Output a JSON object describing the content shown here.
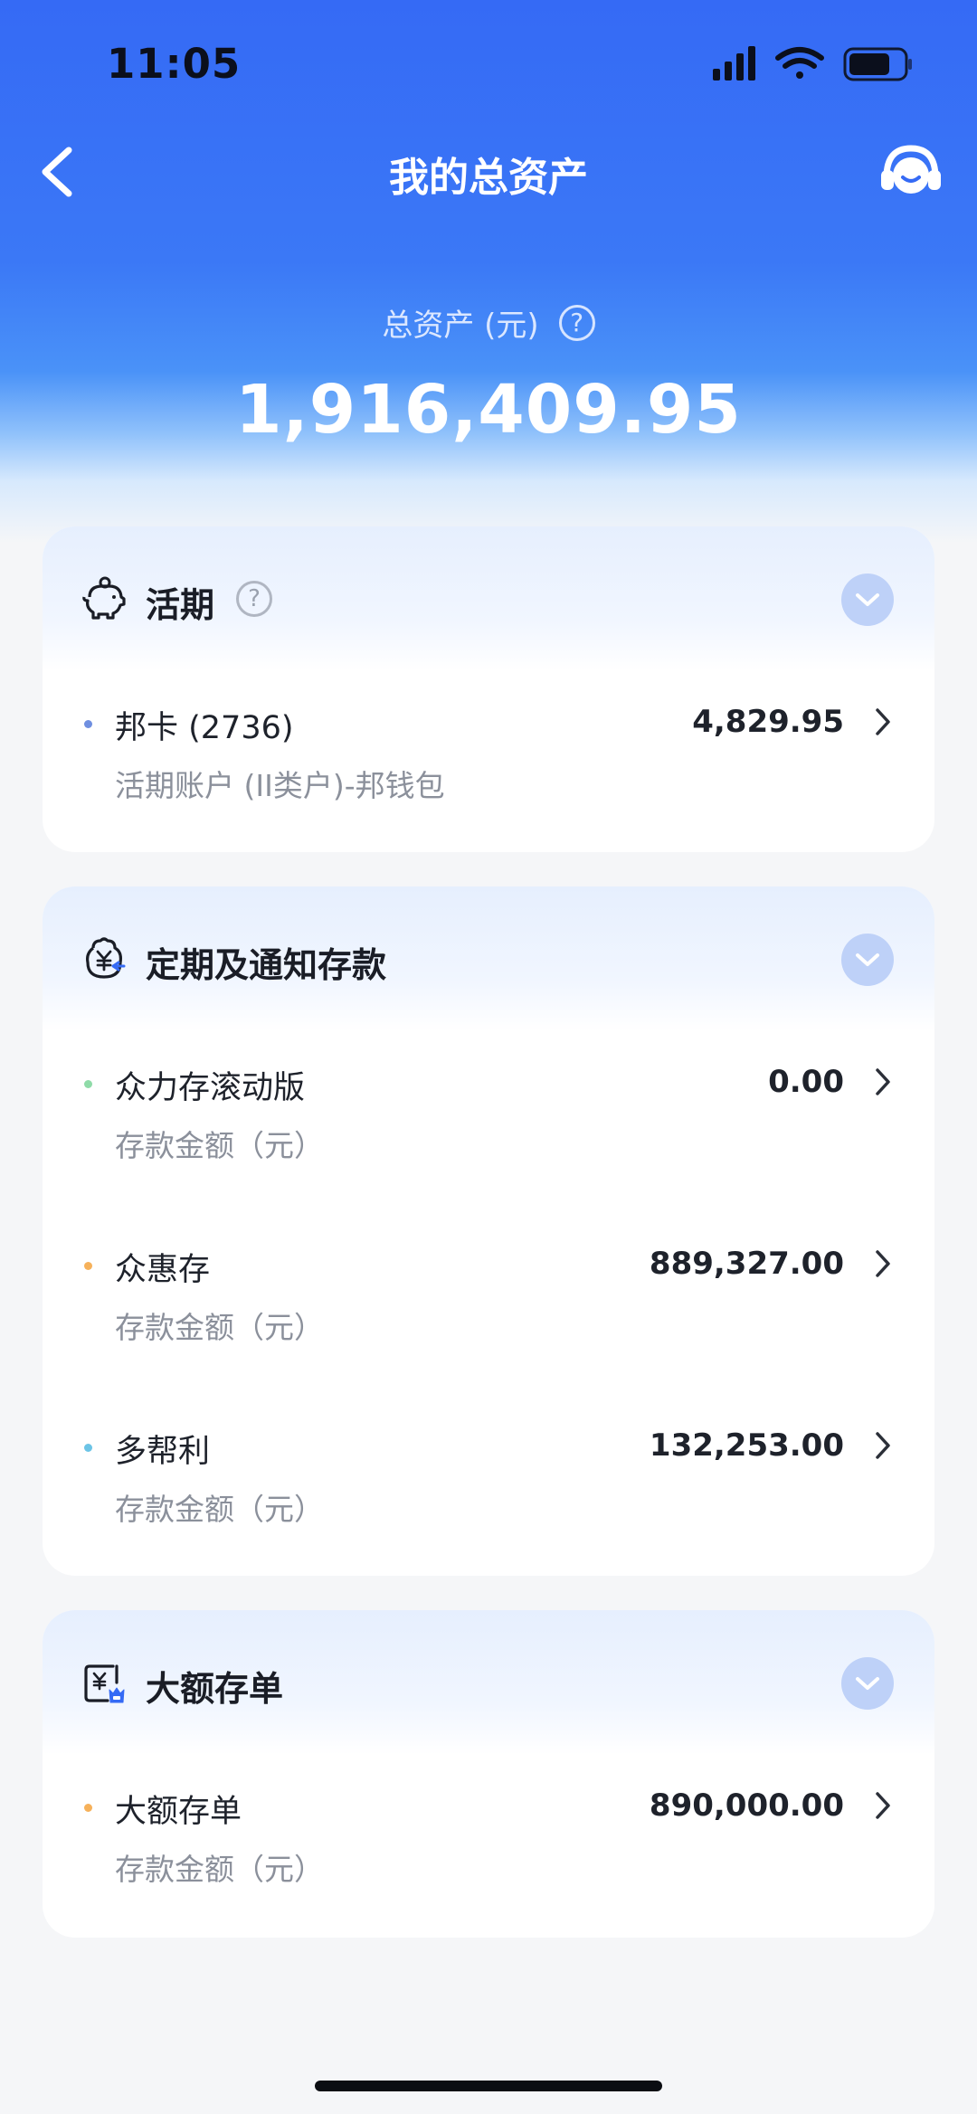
{
  "status_bar": {
    "time": "11:05"
  },
  "nav": {
    "title": "我的总资产"
  },
  "summary": {
    "label": "总资产 (元)",
    "help_symbol": "?",
    "total": "1,916,409.95"
  },
  "sections": {
    "demand": {
      "title": "活期",
      "help_symbol": "?",
      "items": [
        {
          "name": "邦卡 (2736)",
          "subtitle": "活期账户 (II类户)-邦钱包",
          "amount": "4,829.95",
          "dot_color": "#6f8fe0"
        }
      ]
    },
    "fixed": {
      "title": "定期及通知存款",
      "items": [
        {
          "name": "众力存滚动版",
          "subtitle": "存款金额（元）",
          "amount": "0.00",
          "dot_color": "#8fdba8"
        },
        {
          "name": "众惠存",
          "subtitle": "存款金额（元）",
          "amount": "889,327.00",
          "dot_color": "#f6b15a"
        },
        {
          "name": "多帮利",
          "subtitle": "存款金额（元）",
          "amount": "132,253.00",
          "dot_color": "#6cc4e6"
        }
      ]
    },
    "cd": {
      "title": "大额存单",
      "items": [
        {
          "name": "大额存单",
          "subtitle": "存款金额（元）",
          "amount": "890,000.00",
          "dot_color": "#f6b15a"
        }
      ]
    }
  },
  "colors": {
    "primary_blue": "#356af5",
    "toggle_blue": "#bed1f8"
  },
  "icons": [
    "back-arrow-icon",
    "customer-service-icon",
    "help-icon",
    "piggy-bank-icon",
    "deposit-yen-icon",
    "certificate-icon",
    "chevron-down-icon",
    "chevron-right-icon",
    "signal-icon",
    "wifi-icon",
    "battery-icon"
  ]
}
